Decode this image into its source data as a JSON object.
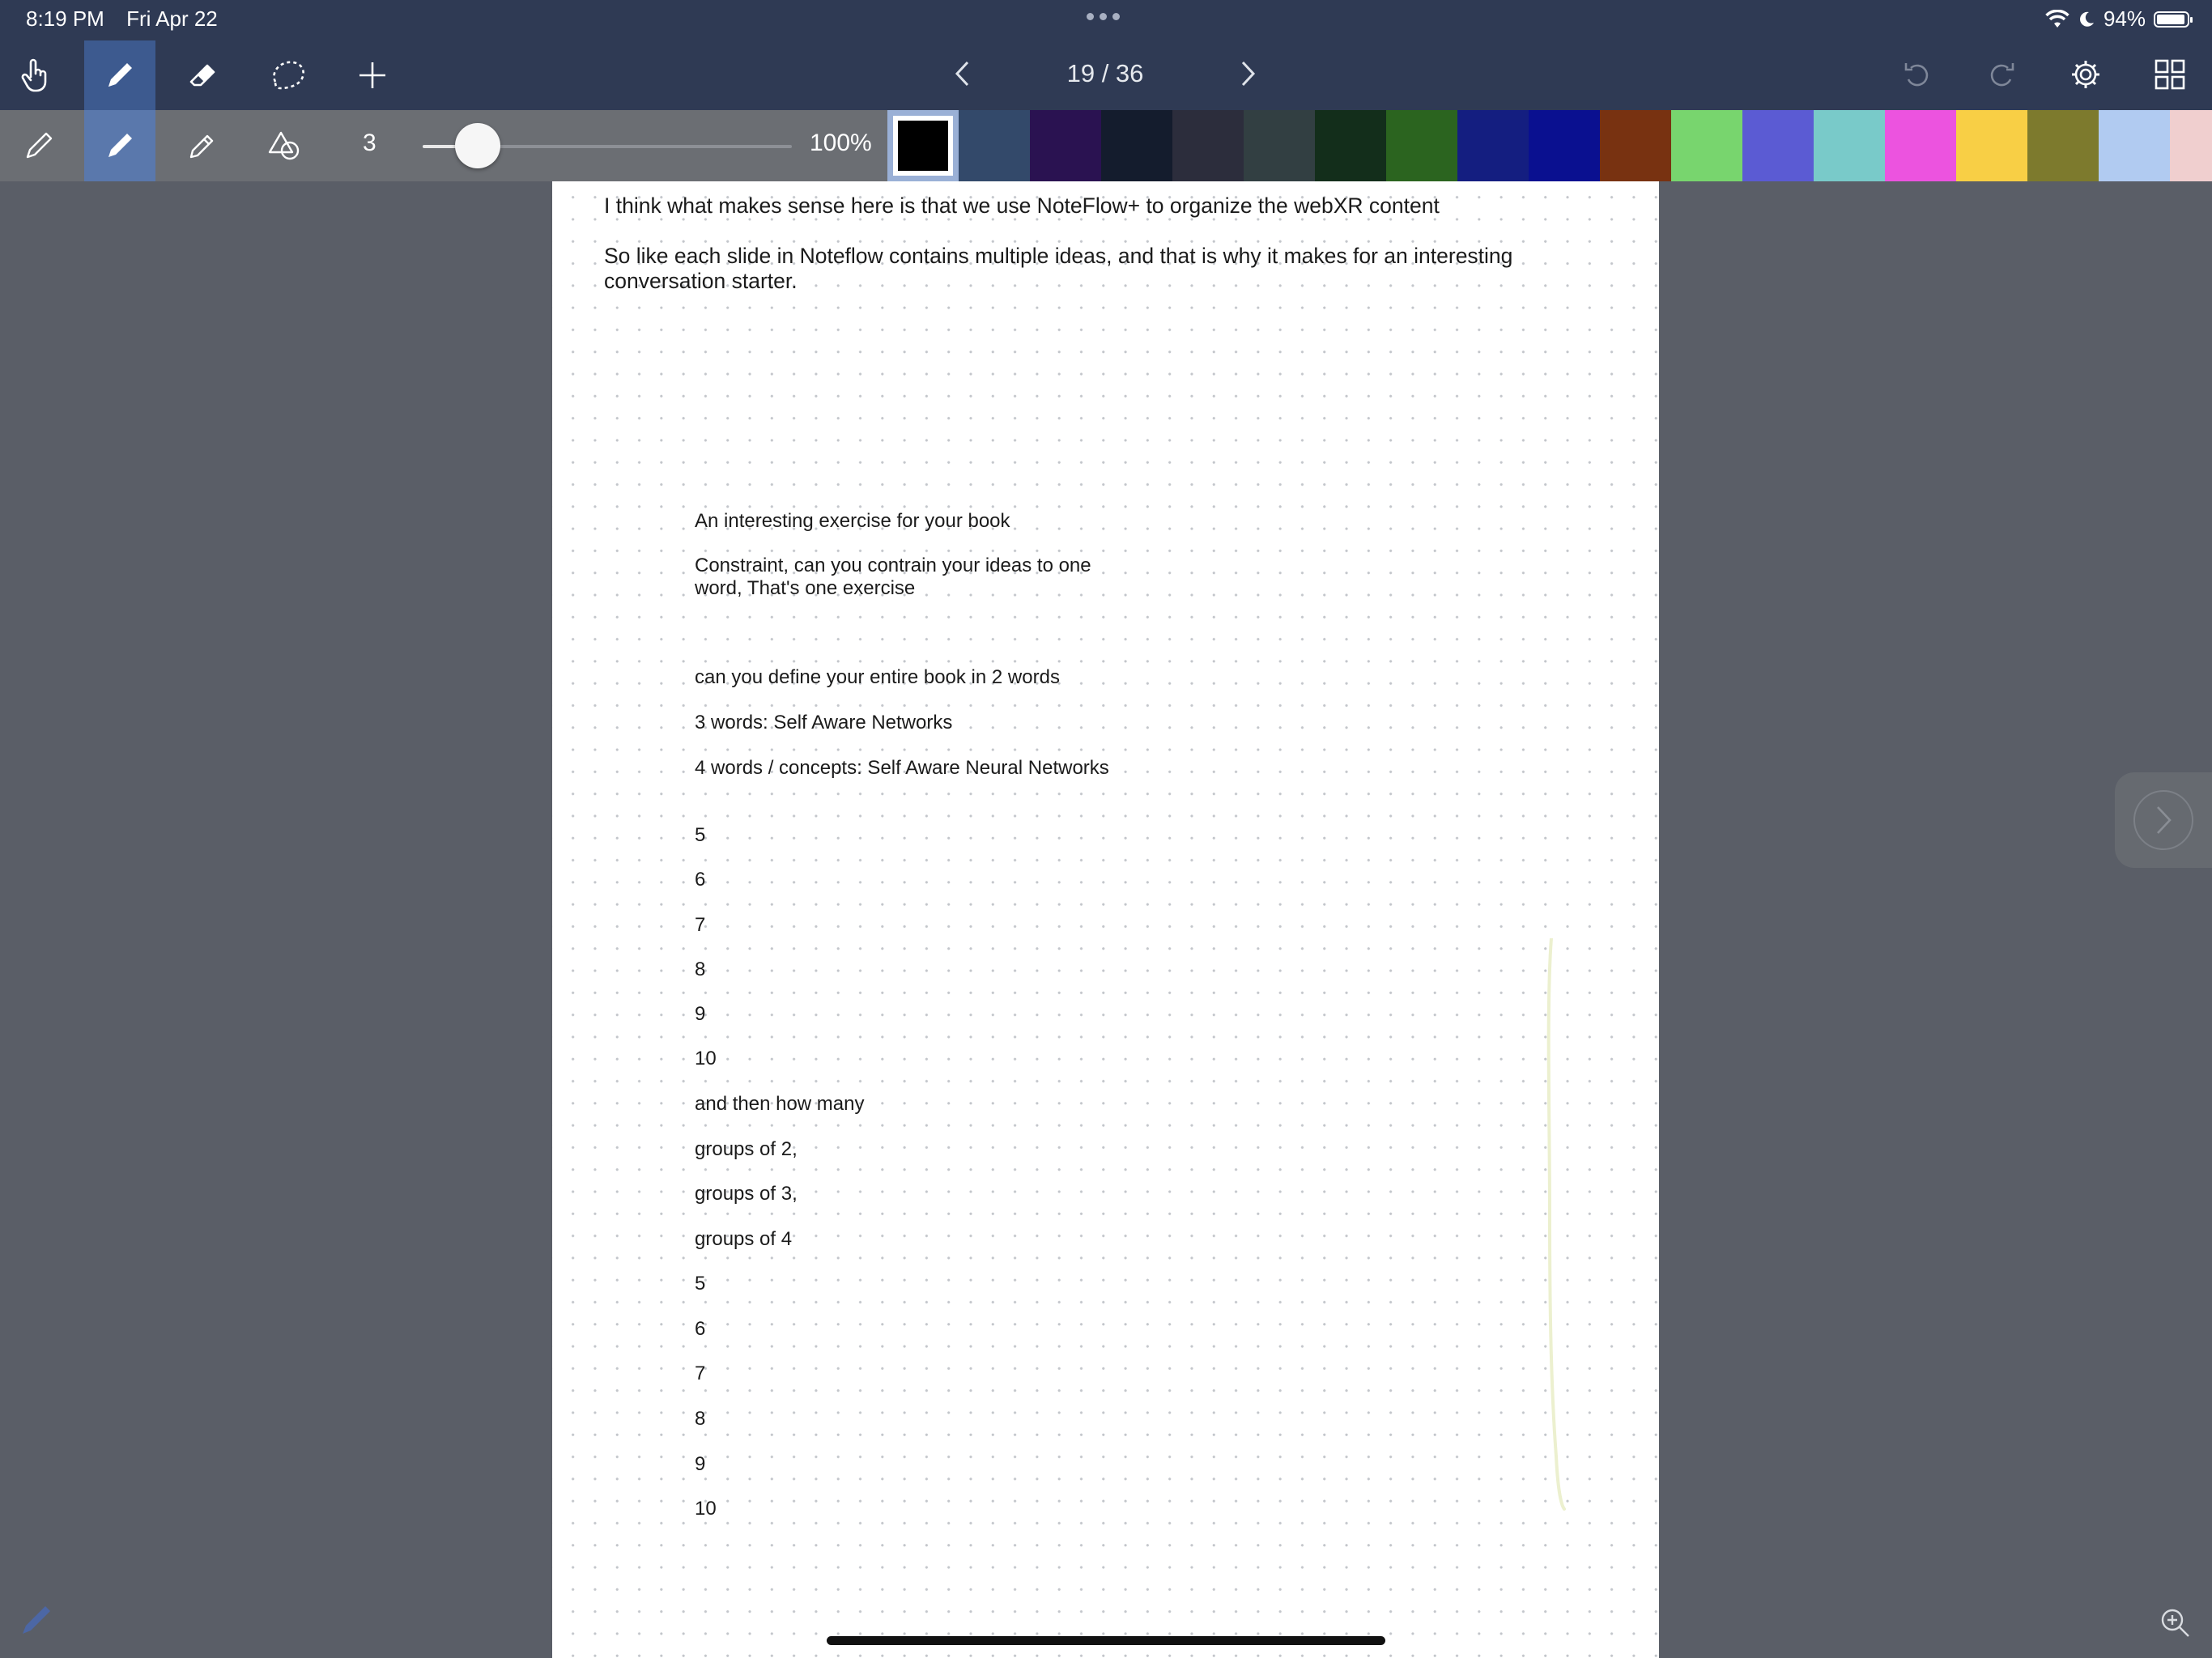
{
  "status_bar": {
    "time": "8:19 PM",
    "date": "Fri Apr 22",
    "battery": "94%"
  },
  "top_toolbar": {
    "tools": [
      "hand-tool",
      "pen-tool",
      "eraser-tool",
      "lasso-tool",
      "add-tool"
    ],
    "active_tool": "pen-tool",
    "page_indicator": "19 / 36",
    "right_tools": [
      "undo-icon",
      "redo-icon",
      "gear-icon",
      "grid-icon"
    ]
  },
  "pen_toolbar": {
    "pen_types": [
      "fine-pen",
      "marker-pen",
      "highlighter-pen",
      "shapes-tool"
    ],
    "active_pen": "marker-pen",
    "thickness": "3",
    "thickness_level": 0.15,
    "zoom": "100%"
  },
  "colors": {
    "selected": "#000000",
    "palette": [
      "#000000",
      "#33496a",
      "#2a1251",
      "#141c2d",
      "#2c2d3c",
      "#323f42",
      "#132e1b",
      "#2b641f",
      "#141e80",
      "#0a1090",
      "#783211",
      "#78d56e",
      "#5b5bd3",
      "#79cac9",
      "#ec53df",
      "#f8cf45",
      "#7d7a2d",
      "#b1cbf1",
      "#f0cfcf"
    ]
  },
  "page": {
    "paragraphs": [
      "I think what makes sense here is that we use NoteFlow+ to organize the webXR content",
      "So like each slide in Noteflow contains multiple ideas, and that is why it makes for an interesting conversation starter."
    ],
    "notes": [
      "An interesting exercise for your book",
      "Constraint, can you contrain your ideas to one word, That's one exercise",
      "can you define your entire book in 2 words",
      "3 words: Self Aware Networks",
      "4 words / concepts: Self Aware Neural Networks",
      "5",
      "6",
      "7",
      "8",
      "9",
      "10",
      "and then how many",
      "groups of 2,",
      "groups of 3,",
      "groups of 4",
      "5",
      "6",
      "7",
      "8",
      "9",
      "10"
    ]
  }
}
